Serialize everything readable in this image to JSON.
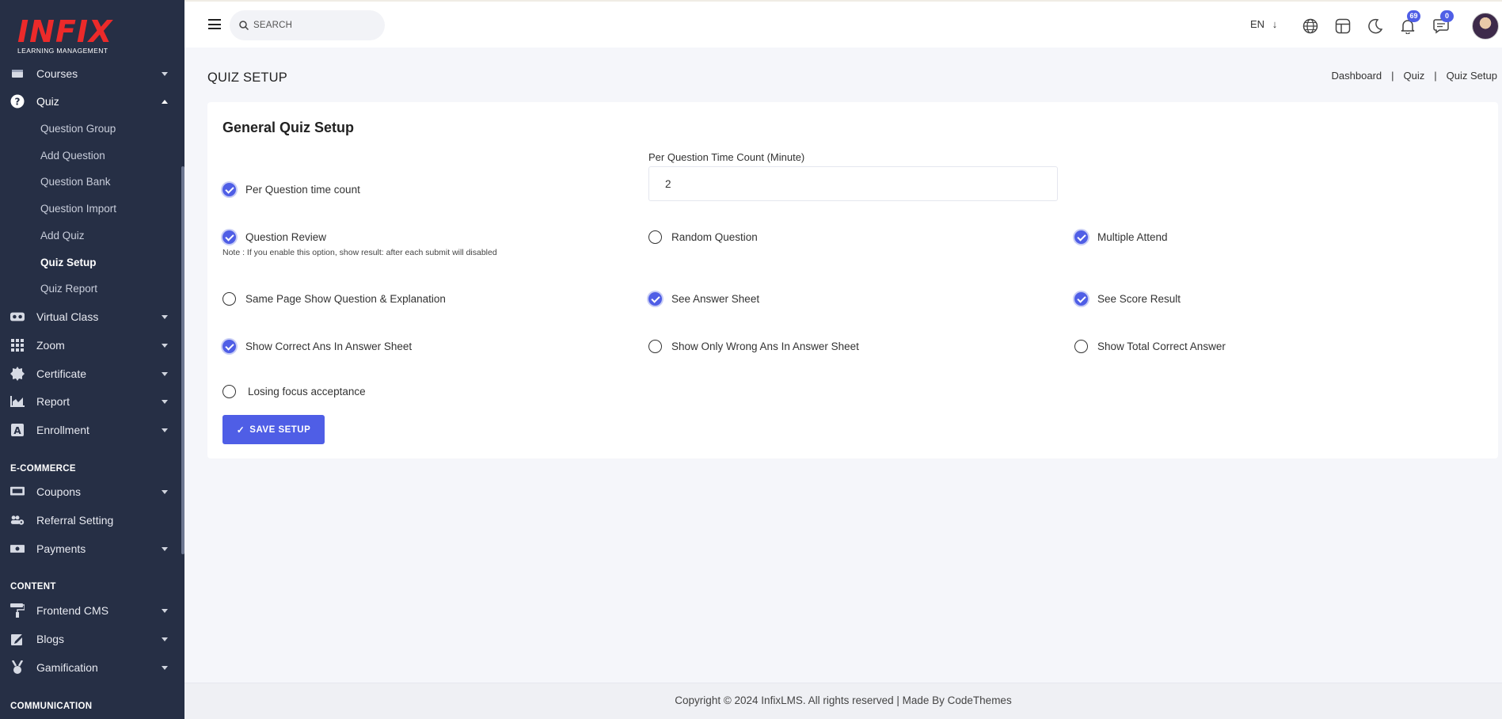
{
  "brand": {
    "logo_main": "INFIX",
    "logo_sub": "LEARNING MANAGEMENT"
  },
  "sidebar": {
    "items": [
      {
        "label": "Courses",
        "icon": "courses-icon"
      },
      {
        "label": "Quiz",
        "icon": "question-circle-icon"
      },
      {
        "label": "Virtual Class",
        "icon": "vr-icon"
      },
      {
        "label": "Zoom",
        "icon": "grid-icon"
      },
      {
        "label": "Certificate",
        "icon": "certificate-icon"
      },
      {
        "label": "Report",
        "icon": "chart-icon"
      },
      {
        "label": "Enrollment",
        "icon": "enrollment-icon"
      },
      {
        "label": "Coupons",
        "icon": "coupon-icon"
      },
      {
        "label": "Referral Setting",
        "icon": "users-gear-icon"
      },
      {
        "label": "Payments",
        "icon": "money-icon"
      },
      {
        "label": "Frontend CMS",
        "icon": "paint-roller-icon"
      },
      {
        "label": "Blogs",
        "icon": "edit-icon"
      },
      {
        "label": "Gamification",
        "icon": "medal-icon"
      }
    ],
    "quiz_sub": [
      "Question Group",
      "Add Question",
      "Question Bank",
      "Question Import",
      "Add Quiz",
      "Quiz Setup",
      "Quiz Report"
    ],
    "sections": {
      "ecommerce": "E-COMMERCE",
      "content": "CONTENT",
      "communication": "COMMUNICATION"
    }
  },
  "topbar": {
    "search_placeholder": "SEARCH",
    "language": "EN",
    "notifications_count": "69",
    "messages_count": "0"
  },
  "page": {
    "title": "QUIZ SETUP",
    "breadcrumb": [
      "Dashboard",
      "Quiz",
      "Quiz Setup"
    ]
  },
  "form": {
    "card_title": "General Quiz Setup",
    "time_label": "Per Question Time Count (Minute)",
    "time_value": "2",
    "note": "Note : If you enable this option, show result: after each submit will disabled",
    "options": [
      {
        "label": "Per Question time count",
        "checked": true
      },
      {
        "label": "Question Review",
        "checked": true
      },
      {
        "label": "Random Question",
        "checked": false
      },
      {
        "label": "Multiple Attend",
        "checked": true
      },
      {
        "label": "Same Page Show Question & Explanation",
        "checked": false
      },
      {
        "label": "See Answer Sheet",
        "checked": true
      },
      {
        "label": "See Score Result",
        "checked": true
      },
      {
        "label": "Show Correct Ans In Answer Sheet",
        "checked": true
      },
      {
        "label": "Show Only Wrong Ans In Answer Sheet",
        "checked": false
      },
      {
        "label": "Show Total Correct Answer",
        "checked": false
      },
      {
        "label": "Losing focus acceptance",
        "checked": false
      }
    ],
    "save_label": "SAVE SETUP"
  },
  "footer": {
    "copyright": "Copyright © 2024 InfixLMS. All rights reserved | Made By CodeThemes"
  },
  "colors": {
    "sidebar_bg": "#262f45",
    "accent": "#4f5ee6",
    "logo_red": "#ec2a2a"
  }
}
